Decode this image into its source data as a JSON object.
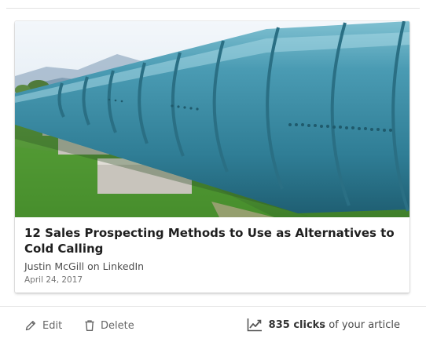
{
  "article": {
    "title": "12 Sales Prospecting Methods to Use as Alternatives to Cold Calling",
    "author_line": "Justin McGill on LinkedIn",
    "date": "April 24, 2017",
    "image_icon": "pipeline-photo"
  },
  "actions": {
    "edit_label": "Edit",
    "edit_icon": "pencil-icon",
    "delete_label": "Delete",
    "delete_icon": "trash-icon"
  },
  "stats": {
    "icon": "trend-chart-icon",
    "clicks_label": "835 clicks",
    "suffix": "of your article"
  },
  "colors": {
    "pipe": "#3f8fa6",
    "grass": "#5aa136",
    "sky": "#eaf1f6",
    "text_muted": "#666666"
  }
}
